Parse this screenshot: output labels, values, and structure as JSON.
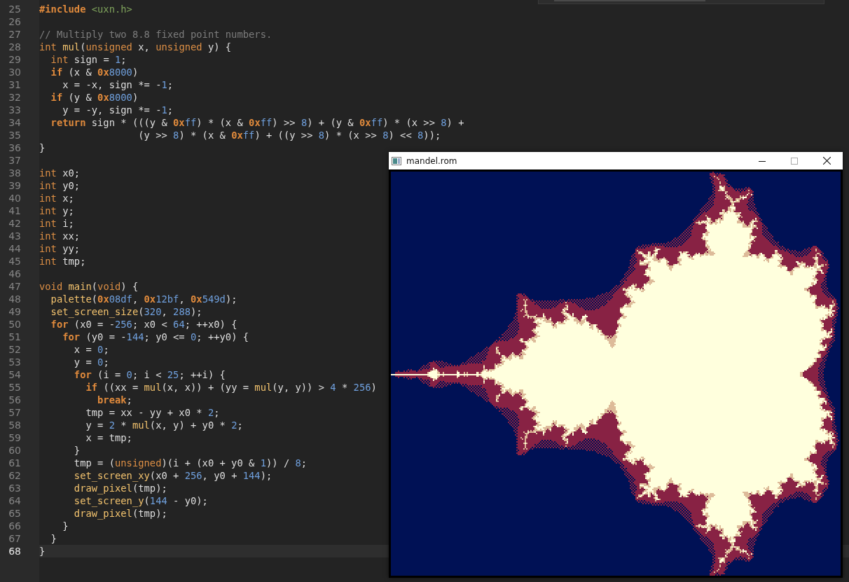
{
  "editor": {
    "lines": [
      {
        "number": "25",
        "current": false,
        "segments": [
          {
            "kind": "keyword",
            "text": "#include"
          },
          {
            "kind": "string",
            "text": " <uxn.h>"
          }
        ]
      },
      {
        "number": "26",
        "current": false
      },
      {
        "number": "27",
        "current": false,
        "segments": [
          {
            "kind": "comment",
            "text": "// Multiply two 8.8 fixed point numbers."
          }
        ]
      },
      {
        "number": "28",
        "current": false,
        "segments": [
          {
            "kind": "type",
            "text": "int"
          },
          {
            "kind": "function",
            "text": " mul"
          },
          {
            "kind": "text",
            "text": "("
          },
          {
            "kind": "type",
            "text": "unsigned"
          },
          {
            "kind": "text",
            "text": " x, "
          },
          {
            "kind": "type",
            "text": "unsigned"
          },
          {
            "kind": "text",
            "text": " y) {"
          }
        ]
      },
      {
        "number": "29",
        "current": false,
        "segments": [
          {
            "kind": "type",
            "text": "  int"
          },
          {
            "kind": "text",
            "text": " sign = "
          },
          {
            "kind": "number",
            "text": "1"
          },
          {
            "kind": "text",
            "text": ";"
          }
        ]
      },
      {
        "number": "30",
        "current": false,
        "segments": [
          {
            "kind": "keyword",
            "text": "  if"
          },
          {
            "kind": "text",
            "text": " (x & "
          },
          {
            "kind": "prefix",
            "text": "0x"
          },
          {
            "kind": "number",
            "text": "8000"
          },
          {
            "kind": "text",
            "text": ")"
          }
        ]
      },
      {
        "number": "31",
        "current": false,
        "segments": [
          {
            "kind": "text",
            "text": "    x = -x, sign *= -"
          },
          {
            "kind": "number",
            "text": "1"
          },
          {
            "kind": "text",
            "text": ";"
          }
        ]
      },
      {
        "number": "32",
        "current": false,
        "segments": [
          {
            "kind": "keyword",
            "text": "  if"
          },
          {
            "kind": "text",
            "text": " (y & "
          },
          {
            "kind": "prefix",
            "text": "0x"
          },
          {
            "kind": "number",
            "text": "8000"
          },
          {
            "kind": "text",
            "text": ")"
          }
        ]
      },
      {
        "number": "33",
        "current": false,
        "segments": [
          {
            "kind": "text",
            "text": "    y = -y, sign *= -"
          },
          {
            "kind": "number",
            "text": "1"
          },
          {
            "kind": "text",
            "text": ";"
          }
        ]
      },
      {
        "number": "34",
        "current": false,
        "segments": [
          {
            "kind": "keyword",
            "text": "  return"
          },
          {
            "kind": "text",
            "text": " sign * (((y & "
          },
          {
            "kind": "prefix",
            "text": "0x"
          },
          {
            "kind": "number",
            "text": "ff"
          },
          {
            "kind": "text",
            "text": ") * (x & "
          },
          {
            "kind": "prefix",
            "text": "0x"
          },
          {
            "kind": "number",
            "text": "ff"
          },
          {
            "kind": "text",
            "text": ") >> "
          },
          {
            "kind": "number",
            "text": "8"
          },
          {
            "kind": "text",
            "text": ") + (y & "
          },
          {
            "kind": "prefix",
            "text": "0x"
          },
          {
            "kind": "number",
            "text": "ff"
          },
          {
            "kind": "text",
            "text": ") * (x >> "
          },
          {
            "kind": "number",
            "text": "8"
          },
          {
            "kind": "text",
            "text": ") +"
          }
        ]
      },
      {
        "number": "35",
        "current": false,
        "segments": [
          {
            "kind": "text",
            "text": "                 (y >> "
          },
          {
            "kind": "number",
            "text": "8"
          },
          {
            "kind": "text",
            "text": ") * (x & "
          },
          {
            "kind": "prefix",
            "text": "0x"
          },
          {
            "kind": "number",
            "text": "ff"
          },
          {
            "kind": "text",
            "text": ") + ((y >> "
          },
          {
            "kind": "number",
            "text": "8"
          },
          {
            "kind": "text",
            "text": ") * (x >> "
          },
          {
            "kind": "number",
            "text": "8"
          },
          {
            "kind": "text",
            "text": ") << "
          },
          {
            "kind": "number",
            "text": "8"
          },
          {
            "kind": "text",
            "text": "));"
          }
        ]
      },
      {
        "number": "36",
        "current": false,
        "segments": [
          {
            "kind": "text",
            "text": "}"
          }
        ]
      },
      {
        "number": "37",
        "current": false
      },
      {
        "number": "38",
        "current": false,
        "segments": [
          {
            "kind": "type",
            "text": "int"
          },
          {
            "kind": "text",
            "text": " x0;"
          }
        ]
      },
      {
        "number": "39",
        "current": false,
        "segments": [
          {
            "kind": "type",
            "text": "int"
          },
          {
            "kind": "text",
            "text": " y0;"
          }
        ]
      },
      {
        "number": "40",
        "current": false,
        "segments": [
          {
            "kind": "type",
            "text": "int"
          },
          {
            "kind": "text",
            "text": " x;"
          }
        ]
      },
      {
        "number": "41",
        "current": false,
        "segments": [
          {
            "kind": "type",
            "text": "int"
          },
          {
            "kind": "text",
            "text": " y;"
          }
        ]
      },
      {
        "number": "42",
        "current": false,
        "segments": [
          {
            "kind": "type",
            "text": "int"
          },
          {
            "kind": "text",
            "text": " i;"
          }
        ]
      },
      {
        "number": "43",
        "current": false,
        "segments": [
          {
            "kind": "type",
            "text": "int"
          },
          {
            "kind": "text",
            "text": " xx;"
          }
        ]
      },
      {
        "number": "44",
        "current": false,
        "segments": [
          {
            "kind": "type",
            "text": "int"
          },
          {
            "kind": "text",
            "text": " yy;"
          }
        ]
      },
      {
        "number": "45",
        "current": false,
        "segments": [
          {
            "kind": "type",
            "text": "int"
          },
          {
            "kind": "text",
            "text": " tmp;"
          }
        ]
      },
      {
        "number": "46",
        "current": false
      },
      {
        "number": "47",
        "current": false,
        "segments": [
          {
            "kind": "type",
            "text": "void"
          },
          {
            "kind": "function",
            "text": " main"
          },
          {
            "kind": "text",
            "text": "("
          },
          {
            "kind": "type",
            "text": "void"
          },
          {
            "kind": "text",
            "text": ") {"
          }
        ]
      },
      {
        "number": "48",
        "current": false,
        "segments": [
          {
            "kind": "function",
            "text": "  palette"
          },
          {
            "kind": "text",
            "text": "("
          },
          {
            "kind": "prefix",
            "text": "0x"
          },
          {
            "kind": "number",
            "text": "08df"
          },
          {
            "kind": "text",
            "text": ", "
          },
          {
            "kind": "prefix",
            "text": "0x"
          },
          {
            "kind": "number",
            "text": "12bf"
          },
          {
            "kind": "text",
            "text": ", "
          },
          {
            "kind": "prefix",
            "text": "0x"
          },
          {
            "kind": "number",
            "text": "549d"
          },
          {
            "kind": "text",
            "text": ");"
          }
        ]
      },
      {
        "number": "49",
        "current": false,
        "segments": [
          {
            "kind": "function",
            "text": "  set_screen_size"
          },
          {
            "kind": "text",
            "text": "("
          },
          {
            "kind": "number",
            "text": "320"
          },
          {
            "kind": "text",
            "text": ", "
          },
          {
            "kind": "number",
            "text": "288"
          },
          {
            "kind": "text",
            "text": ");"
          }
        ]
      },
      {
        "number": "50",
        "current": false,
        "segments": [
          {
            "kind": "keyword",
            "text": "  for"
          },
          {
            "kind": "text",
            "text": " (x0 = -"
          },
          {
            "kind": "number",
            "text": "256"
          },
          {
            "kind": "text",
            "text": "; x0 < "
          },
          {
            "kind": "number",
            "text": "64"
          },
          {
            "kind": "text",
            "text": "; ++x0) {"
          }
        ]
      },
      {
        "number": "51",
        "current": false,
        "segments": [
          {
            "kind": "keyword",
            "text": "    for"
          },
          {
            "kind": "text",
            "text": " (y0 = -"
          },
          {
            "kind": "number",
            "text": "144"
          },
          {
            "kind": "text",
            "text": "; y0 <= "
          },
          {
            "kind": "number",
            "text": "0"
          },
          {
            "kind": "text",
            "text": "; ++y0) {"
          }
        ]
      },
      {
        "number": "52",
        "current": false,
        "segments": [
          {
            "kind": "text",
            "text": "      x = "
          },
          {
            "kind": "number",
            "text": "0"
          },
          {
            "kind": "text",
            "text": ";"
          }
        ]
      },
      {
        "number": "53",
        "current": false,
        "segments": [
          {
            "kind": "text",
            "text": "      y = "
          },
          {
            "kind": "number",
            "text": "0"
          },
          {
            "kind": "text",
            "text": ";"
          }
        ]
      },
      {
        "number": "54",
        "current": false,
        "segments": [
          {
            "kind": "keyword",
            "text": "      for"
          },
          {
            "kind": "text",
            "text": " (i = "
          },
          {
            "kind": "number",
            "text": "0"
          },
          {
            "kind": "text",
            "text": "; i < "
          },
          {
            "kind": "number",
            "text": "25"
          },
          {
            "kind": "text",
            "text": "; ++i) {"
          }
        ]
      },
      {
        "number": "55",
        "current": false,
        "segments": [
          {
            "kind": "keyword",
            "text": "        if"
          },
          {
            "kind": "text",
            "text": " ((xx = "
          },
          {
            "kind": "function",
            "text": "mul"
          },
          {
            "kind": "text",
            "text": "(x, x)) + (yy = "
          },
          {
            "kind": "function",
            "text": "mul"
          },
          {
            "kind": "text",
            "text": "(y, y)) > "
          },
          {
            "kind": "number",
            "text": "4"
          },
          {
            "kind": "text",
            "text": " * "
          },
          {
            "kind": "number",
            "text": "256"
          },
          {
            "kind": "text",
            "text": ")"
          }
        ]
      },
      {
        "number": "56",
        "current": false,
        "segments": [
          {
            "kind": "keyword",
            "text": "          break"
          },
          {
            "kind": "text",
            "text": ";"
          }
        ]
      },
      {
        "number": "57",
        "current": false,
        "segments": [
          {
            "kind": "text",
            "text": "        tmp = xx - yy + x0 * "
          },
          {
            "kind": "number",
            "text": "2"
          },
          {
            "kind": "text",
            "text": ";"
          }
        ]
      },
      {
        "number": "58",
        "current": false,
        "segments": [
          {
            "kind": "text",
            "text": "        y = "
          },
          {
            "kind": "number",
            "text": "2"
          },
          {
            "kind": "text",
            "text": " * "
          },
          {
            "kind": "function",
            "text": "mul"
          },
          {
            "kind": "text",
            "text": "(x, y) + y0 * "
          },
          {
            "kind": "number",
            "text": "2"
          },
          {
            "kind": "text",
            "text": ";"
          }
        ]
      },
      {
        "number": "59",
        "current": false,
        "segments": [
          {
            "kind": "text",
            "text": "        x = tmp;"
          }
        ]
      },
      {
        "number": "60",
        "current": false,
        "segments": [
          {
            "kind": "text",
            "text": "      }"
          }
        ]
      },
      {
        "number": "61",
        "current": false,
        "segments": [
          {
            "kind": "text",
            "text": "      tmp = ("
          },
          {
            "kind": "type",
            "text": "unsigned"
          },
          {
            "kind": "text",
            "text": ")(i + (x0 + y0 & "
          },
          {
            "kind": "number",
            "text": "1"
          },
          {
            "kind": "text",
            "text": ")) / "
          },
          {
            "kind": "number",
            "text": "8"
          },
          {
            "kind": "text",
            "text": ";"
          }
        ]
      },
      {
        "number": "62",
        "current": false,
        "segments": [
          {
            "kind": "function",
            "text": "      set_screen_xy"
          },
          {
            "kind": "text",
            "text": "(x0 + "
          },
          {
            "kind": "number",
            "text": "256"
          },
          {
            "kind": "text",
            "text": ", y0 + "
          },
          {
            "kind": "number",
            "text": "144"
          },
          {
            "kind": "text",
            "text": ");"
          }
        ]
      },
      {
        "number": "63",
        "current": false,
        "segments": [
          {
            "kind": "function",
            "text": "      draw_pixel"
          },
          {
            "kind": "text",
            "text": "(tmp);"
          }
        ]
      },
      {
        "number": "64",
        "current": false,
        "segments": [
          {
            "kind": "function",
            "text": "      set_screen_y"
          },
          {
            "kind": "text",
            "text": "("
          },
          {
            "kind": "number",
            "text": "144"
          },
          {
            "kind": "text",
            "text": " - y0);"
          }
        ]
      },
      {
        "number": "65",
        "current": false,
        "segments": [
          {
            "kind": "function",
            "text": "      draw_pixel"
          },
          {
            "kind": "text",
            "text": "(tmp);"
          }
        ]
      },
      {
        "number": "66",
        "current": false,
        "segments": [
          {
            "kind": "text",
            "text": "    }"
          }
        ]
      },
      {
        "number": "67",
        "current": false,
        "segments": [
          {
            "kind": "text",
            "text": "  }"
          }
        ]
      },
      {
        "number": "68",
        "current": true,
        "segments": [
          {
            "kind": "text",
            "text": "}"
          }
        ]
      }
    ]
  },
  "window": {
    "title": "mandel.rom"
  }
}
